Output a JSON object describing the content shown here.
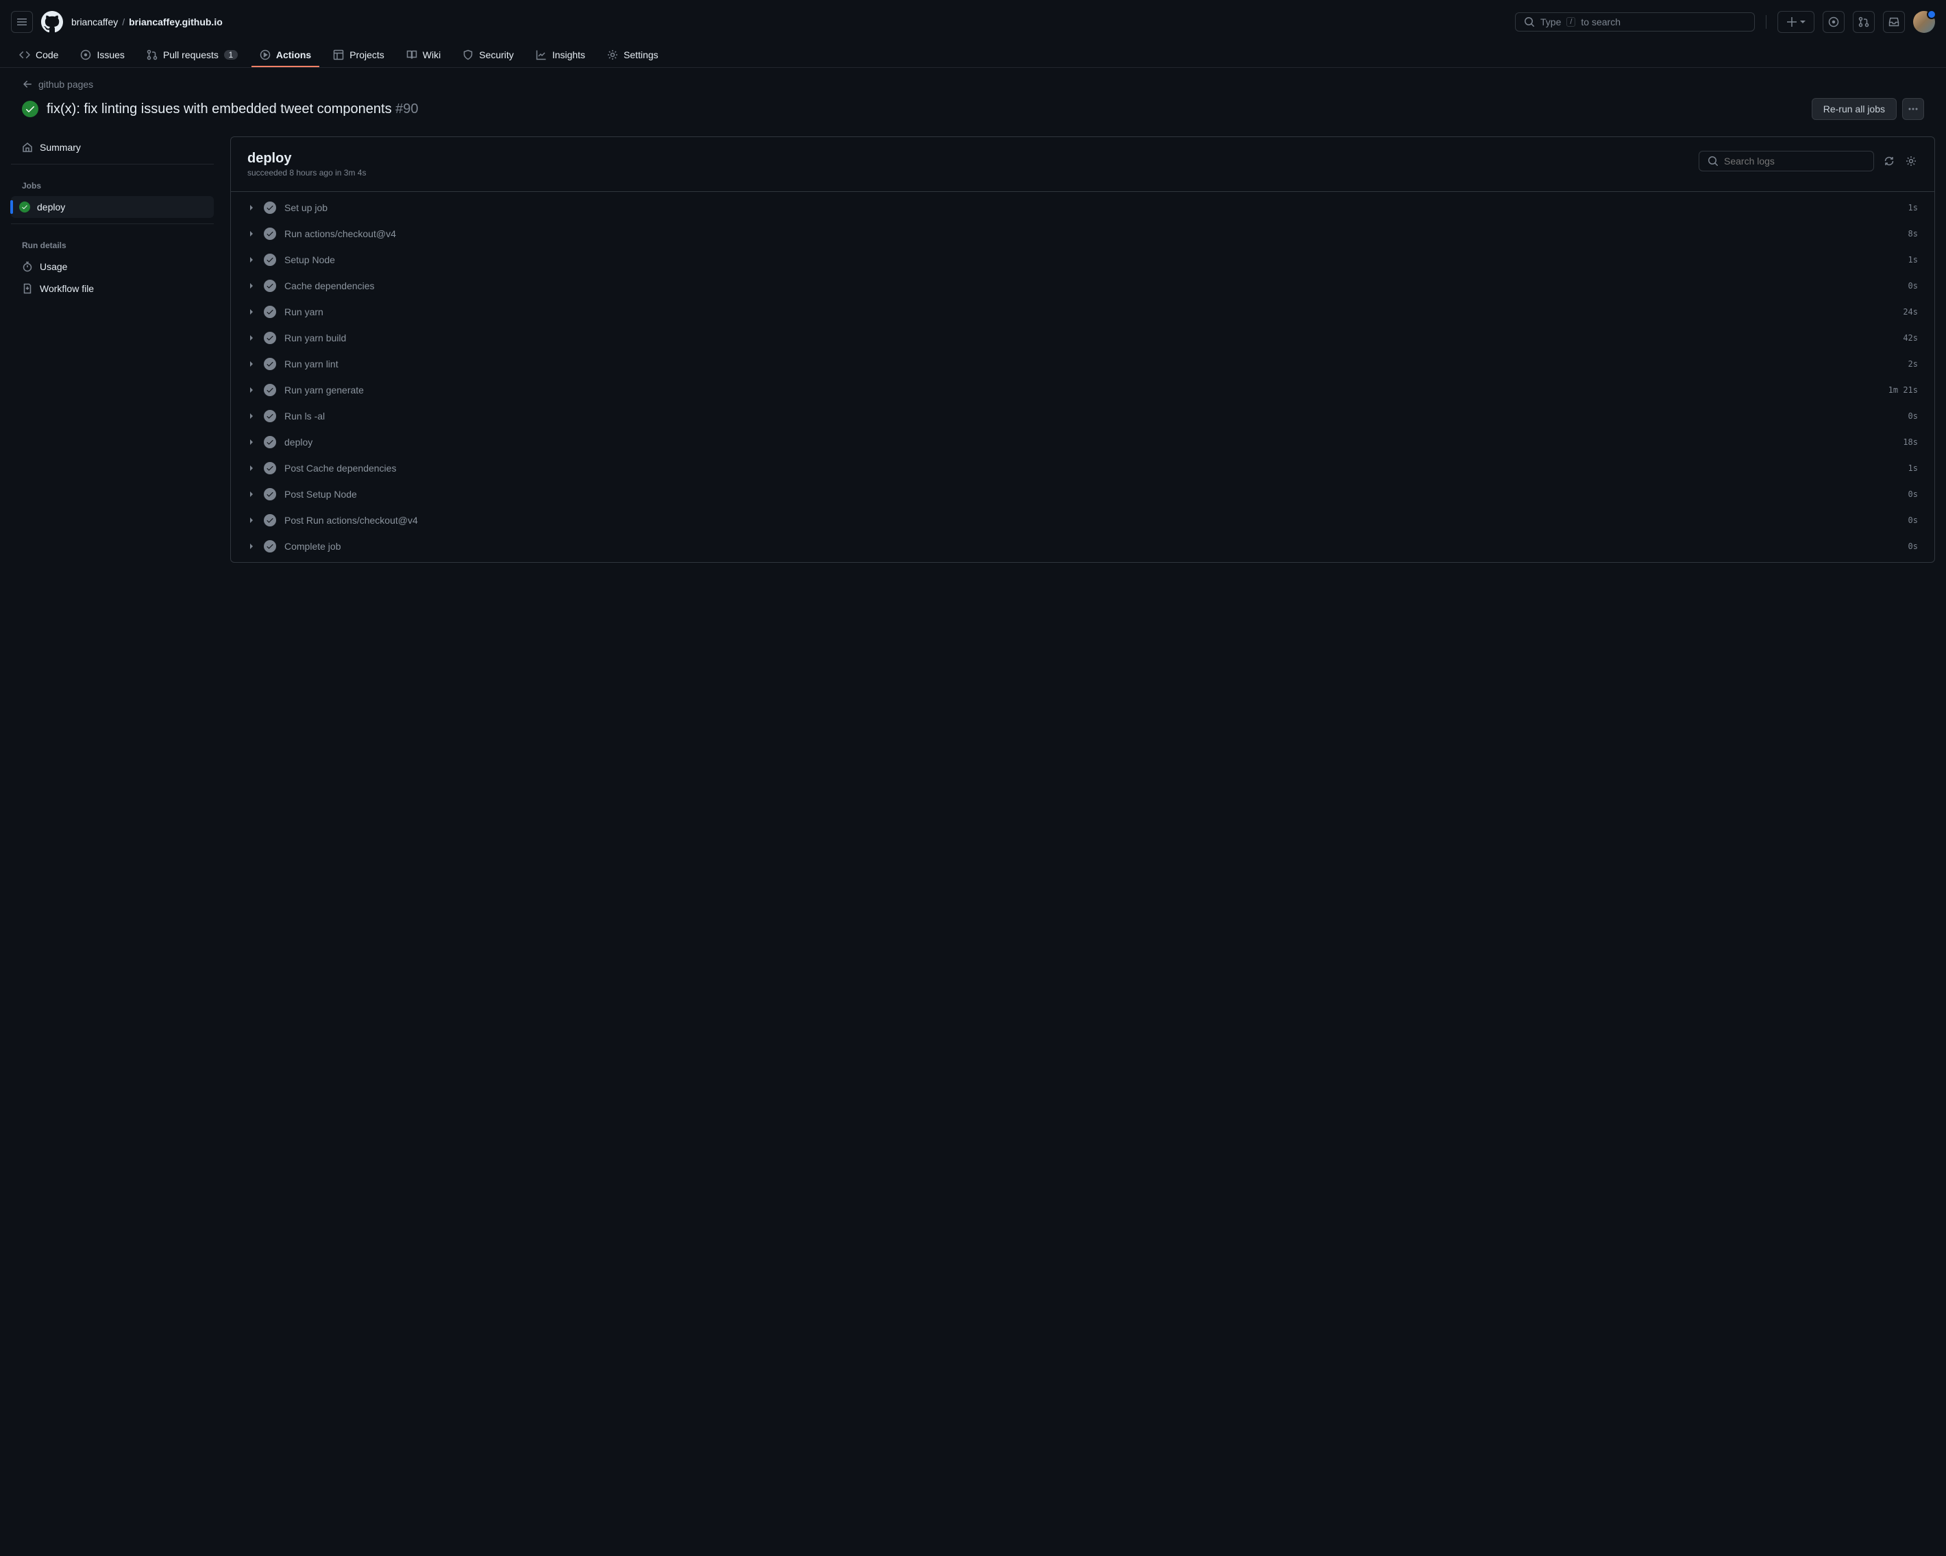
{
  "header": {
    "owner": "briancaffey",
    "repo": "briancaffey.github.io",
    "search_prefix": "Type",
    "search_key": "/",
    "search_suffix": "to search"
  },
  "repoNav": {
    "code": "Code",
    "issues": "Issues",
    "pullRequests": "Pull requests",
    "prCount": "1",
    "actions": "Actions",
    "projects": "Projects",
    "wiki": "Wiki",
    "security": "Security",
    "insights": "Insights",
    "settings": "Settings"
  },
  "run": {
    "backLink": "github pages",
    "title": "fix(x): fix linting issues with embedded tweet components",
    "number": "#90",
    "rerunLabel": "Re-run all jobs"
  },
  "sidebar": {
    "summary": "Summary",
    "jobsHeader": "Jobs",
    "jobName": "deploy",
    "runDetailsHeader": "Run details",
    "usage": "Usage",
    "workflowFile": "Workflow file"
  },
  "log": {
    "title": "deploy",
    "subtitle": "succeeded 8 hours ago in 3m 4s",
    "searchPlaceholder": "Search logs",
    "steps": [
      {
        "name": "Set up job",
        "time": "1s"
      },
      {
        "name": "Run actions/checkout@v4",
        "time": "8s"
      },
      {
        "name": "Setup Node",
        "time": "1s"
      },
      {
        "name": "Cache dependencies",
        "time": "0s"
      },
      {
        "name": "Run yarn",
        "time": "24s"
      },
      {
        "name": "Run yarn build",
        "time": "42s"
      },
      {
        "name": "Run yarn lint",
        "time": "2s"
      },
      {
        "name": "Run yarn generate",
        "time": "1m 21s"
      },
      {
        "name": "Run ls -al",
        "time": "0s"
      },
      {
        "name": "deploy",
        "time": "18s"
      },
      {
        "name": "Post Cache dependencies",
        "time": "1s"
      },
      {
        "name": "Post Setup Node",
        "time": "0s"
      },
      {
        "name": "Post Run actions/checkout@v4",
        "time": "0s"
      },
      {
        "name": "Complete job",
        "time": "0s"
      }
    ]
  }
}
